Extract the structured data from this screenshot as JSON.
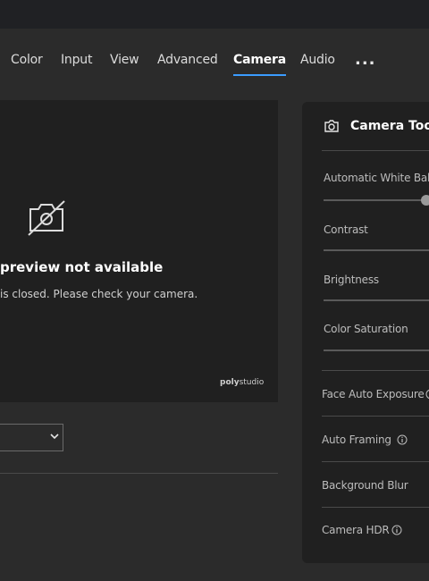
{
  "nav": {
    "tabs": [
      {
        "label": "Color"
      },
      {
        "label": "Input"
      },
      {
        "label": "View"
      },
      {
        "label": "Advanced"
      },
      {
        "label": "Camera"
      },
      {
        "label": "Audio"
      }
    ],
    "active_tab": "Camera",
    "more_label": "..."
  },
  "preview": {
    "title": "preview not available",
    "message": "is closed. Please check your camera.",
    "brand_bold": "poly",
    "brand_light": "studio"
  },
  "camera_tools": {
    "title": "Camera Tools",
    "items": [
      {
        "label": "Automatic White Balar"
      },
      {
        "label": "Contrast"
      },
      {
        "label": "Brightness"
      },
      {
        "label": "Color Saturation"
      },
      {
        "label": "Face Auto Exposure"
      },
      {
        "label": "Auto Framing"
      },
      {
        "label": "Background Blur"
      },
      {
        "label": "Camera HDR"
      }
    ]
  },
  "colors": {
    "accent": "#3b9cff",
    "panel_bg": "#202020",
    "page_bg": "#2b2b2b"
  }
}
